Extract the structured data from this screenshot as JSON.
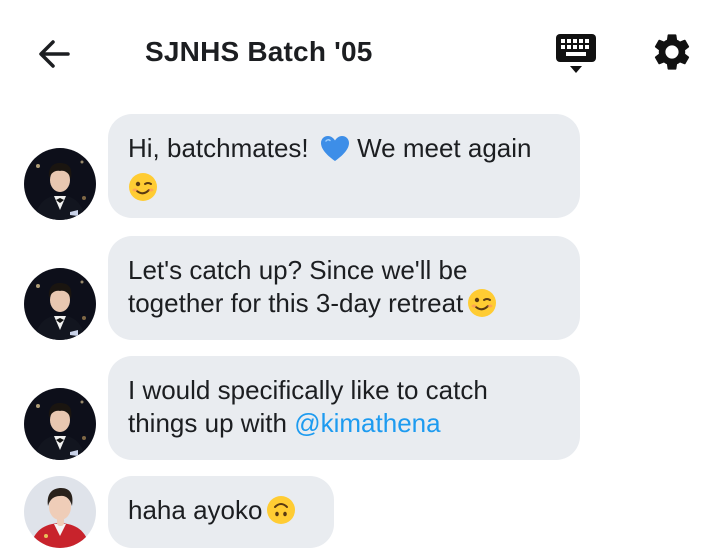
{
  "header": {
    "title": "SJNHS Batch '05",
    "back_icon": "arrow-left-icon",
    "keyboard_icon": "keyboard-icon",
    "settings_icon": "gear-icon"
  },
  "colors": {
    "bubble_bg": "#e9ecf0",
    "mention": "#1d9bf0",
    "text": "#1c1e21"
  },
  "messages": [
    {
      "sender_avatar": "avatar-suit-man",
      "text_before": "Hi, batchmates! ",
      "emoji_1": "blue-heart-emoji",
      "text_after": " We meet again",
      "emoji_2": "wink-emoji"
    },
    {
      "sender_avatar": "avatar-suit-man",
      "line1": "Let's catch up? Since we'll be",
      "line2": "together for this 3-day retreat",
      "emoji": "wink-emoji"
    },
    {
      "sender_avatar": "avatar-suit-man",
      "line1": "I would specifically like to catch",
      "line2_before": "things up with ",
      "mention": "@kimathena"
    },
    {
      "sender_avatar": "avatar-red-jacket",
      "text": "haha ayoko",
      "emoji": "upside-down-face-emoji"
    }
  ]
}
